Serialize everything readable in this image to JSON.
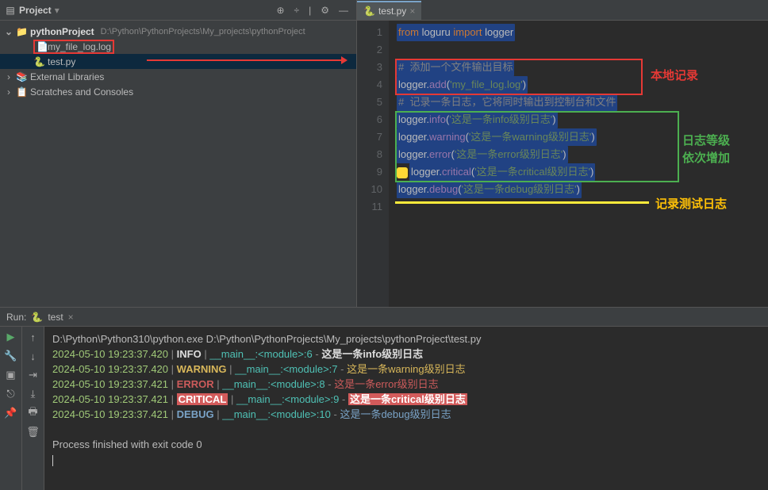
{
  "project_panel": {
    "title": "Project",
    "root": {
      "name": "pythonProject",
      "path": "D:\\Python\\PythonProjects\\My_projects\\pythonProject"
    },
    "files": [
      {
        "name": "my_file_log.log",
        "highlighted": true
      },
      {
        "name": "test.py",
        "selected": true,
        "icon": "python"
      }
    ],
    "external_libs": "External Libraries",
    "scratches": "Scratches and Consoles"
  },
  "editor": {
    "tab_name": "test.py",
    "lines": [
      {
        "n": 1,
        "tokens": [
          [
            "kw",
            "from "
          ],
          [
            "p",
            "loguru "
          ],
          [
            "kw",
            "import "
          ],
          [
            "p",
            "logger"
          ]
        ]
      },
      {
        "n": 2,
        "tokens": []
      },
      {
        "n": 3,
        "tokens": [
          [
            "comment",
            "#  添加一个文件输出目标"
          ]
        ]
      },
      {
        "n": 4,
        "tokens": [
          [
            "p",
            "logger."
          ],
          [
            "attr",
            "add"
          ],
          [
            "p",
            "("
          ],
          [
            "str",
            "'my_file_log.log'"
          ],
          [
            "p",
            ")"
          ]
        ]
      },
      {
        "n": 5,
        "tokens": [
          [
            "comment",
            "#  记录一条日志，它将同时输出到控制台和文件"
          ]
        ]
      },
      {
        "n": 6,
        "tokens": [
          [
            "p",
            "logger."
          ],
          [
            "attr",
            "info"
          ],
          [
            "p",
            "("
          ],
          [
            "str",
            "'这是一条info级别日志'"
          ],
          [
            "p",
            ")"
          ]
        ]
      },
      {
        "n": 7,
        "tokens": [
          [
            "p",
            "logger."
          ],
          [
            "attr",
            "warning"
          ],
          [
            "p",
            "("
          ],
          [
            "str",
            "'这是一条warning级别日志'"
          ],
          [
            "p",
            ")"
          ]
        ]
      },
      {
        "n": 8,
        "tokens": [
          [
            "p",
            "logger."
          ],
          [
            "attr",
            "error"
          ],
          [
            "p",
            "("
          ],
          [
            "str",
            "'这是一条error级别日志'"
          ],
          [
            "p",
            ")"
          ]
        ]
      },
      {
        "n": 9,
        "bulb": true,
        "tokens": [
          [
            "p",
            "logger."
          ],
          [
            "attr",
            "critical"
          ],
          [
            "p",
            "("
          ],
          [
            "str",
            "'这是一条critical级别日志'"
          ],
          [
            "p",
            ")"
          ]
        ]
      },
      {
        "n": 10,
        "tokens": [
          [
            "p",
            "logger."
          ],
          [
            "attr",
            "debug"
          ],
          [
            "p",
            "("
          ],
          [
            "str",
            "'这是一条debug级别日志'"
          ],
          [
            "p",
            ")"
          ]
        ]
      },
      {
        "n": 11,
        "tokens": []
      }
    ],
    "annotations": {
      "local_record": "本地记录",
      "log_level": "日志等级",
      "level_increase": "依次增加",
      "test_log": "记录测试日志"
    }
  },
  "run": {
    "label": "Run:",
    "config": "test",
    "exec_line": "D:\\Python\\Python310\\python.exe D:\\Python\\PythonProjects\\My_projects\\pythonProject\\test.py",
    "rows": [
      {
        "ts": "2024-05-10 19:23:37.420",
        "level": "INFO",
        "level_class": "c-info",
        "loc": "__main__:<module>:6",
        "dash": "-",
        "msg": "这是一条info级别日志",
        "msg_class": "c-info"
      },
      {
        "ts": "2024-05-10 19:23:37.420",
        "level": "WARNING",
        "level_class": "c-warn",
        "loc": "__main__:<module>:7",
        "dash": "-",
        "msg": "这是一条warning级别日志",
        "msg_class": "c-msg-warn"
      },
      {
        "ts": "2024-05-10 19:23:37.421",
        "level": "ERROR",
        "level_class": "c-err",
        "loc": "__main__:<module>:8",
        "dash": "-",
        "msg": "这是一条error级别日志",
        "msg_class": "c-msg-err"
      },
      {
        "ts": "2024-05-10 19:23:37.421",
        "level": "CRITICAL",
        "level_class": "c-crit-bg",
        "loc": "__main__:<module>:9",
        "dash": "-",
        "msg": "这是一条critical级别日志",
        "msg_class": "c-crit-bg"
      },
      {
        "ts": "2024-05-10 19:23:37.421",
        "level": "DEBUG",
        "level_class": "c-debug",
        "loc": "__main__:<module>:10",
        "dash": "-",
        "msg": "这是一条debug级别日志",
        "msg_class": "c-msg-debug"
      }
    ],
    "finished": "Process finished with exit code 0"
  }
}
